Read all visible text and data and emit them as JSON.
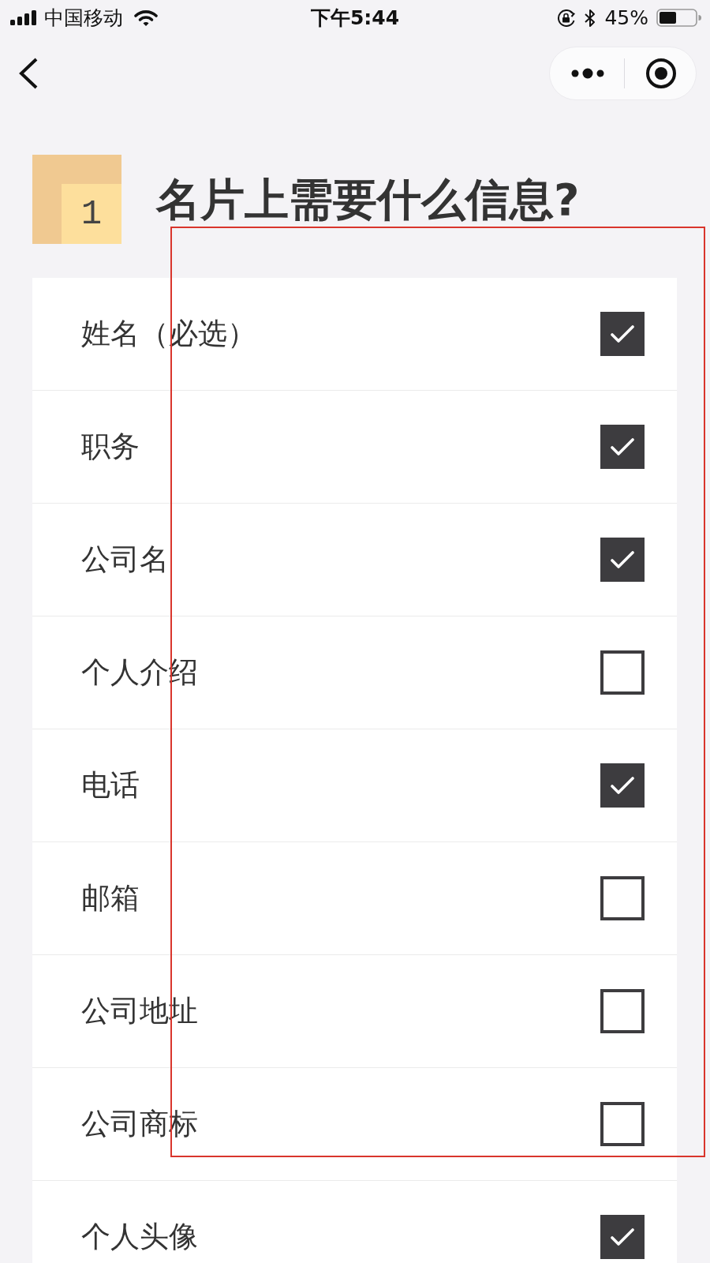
{
  "status_bar": {
    "carrier": "中国移动",
    "time": "下午5:44",
    "battery_percent": "45%"
  },
  "question": {
    "number": "1",
    "title": "名片上需要什么信息?"
  },
  "options": [
    {
      "label": "姓名（必选）",
      "checked": true
    },
    {
      "label": "职务",
      "checked": true
    },
    {
      "label": "公司名",
      "checked": true
    },
    {
      "label": "个人介绍",
      "checked": false
    },
    {
      "label": "电话",
      "checked": true
    },
    {
      "label": "邮箱",
      "checked": false
    },
    {
      "label": "公司地址",
      "checked": false
    },
    {
      "label": "公司商标",
      "checked": false
    },
    {
      "label": "个人头像",
      "checked": true
    }
  ]
}
